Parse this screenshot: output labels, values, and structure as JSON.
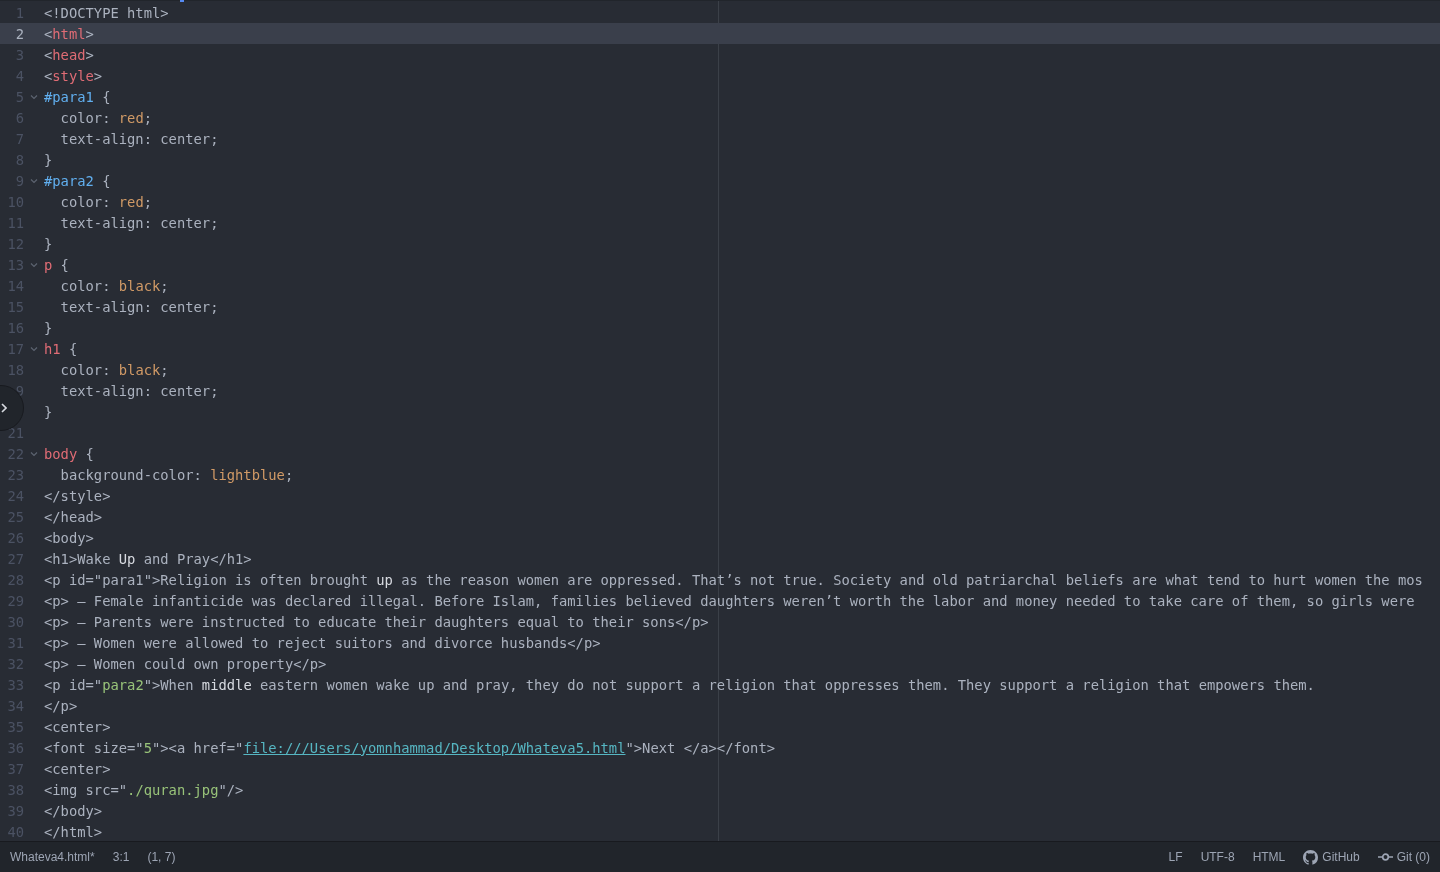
{
  "editor": {
    "lines": [
      {
        "number": "1",
        "fold": false,
        "current": false,
        "tokens": [
          {
            "kind": "text",
            "text": "<!DOCTYPE html>"
          }
        ]
      },
      {
        "number": "2",
        "fold": false,
        "current": true,
        "tokens": [
          {
            "kind": "text",
            "text": "<"
          },
          {
            "kind": "tag",
            "text": "html"
          },
          {
            "kind": "text",
            "text": ">"
          }
        ]
      },
      {
        "number": "3",
        "fold": false,
        "current": false,
        "tokens": [
          {
            "kind": "text",
            "text": "<"
          },
          {
            "kind": "tag",
            "text": "head"
          },
          {
            "kind": "text",
            "text": ">"
          }
        ]
      },
      {
        "number": "4",
        "fold": false,
        "current": false,
        "tokens": [
          {
            "kind": "text",
            "text": "<"
          },
          {
            "kind": "tag",
            "text": "style"
          },
          {
            "kind": "text",
            "text": ">"
          }
        ]
      },
      {
        "number": "5",
        "fold": true,
        "current": false,
        "tokens": [
          {
            "kind": "selector",
            "text": "#para1"
          },
          {
            "kind": "text",
            "text": " {"
          }
        ]
      },
      {
        "number": "6",
        "fold": false,
        "current": false,
        "tokens": [
          {
            "kind": "text",
            "text": "  color: "
          },
          {
            "kind": "value",
            "text": "red"
          },
          {
            "kind": "text",
            "text": ";"
          }
        ]
      },
      {
        "number": "7",
        "fold": false,
        "current": false,
        "tokens": [
          {
            "kind": "text",
            "text": "  text-align: center;"
          }
        ]
      },
      {
        "number": "8",
        "fold": false,
        "current": false,
        "tokens": [
          {
            "kind": "text",
            "text": "}"
          }
        ]
      },
      {
        "number": "9",
        "fold": true,
        "current": false,
        "tokens": [
          {
            "kind": "selector",
            "text": "#para2"
          },
          {
            "kind": "text",
            "text": " {"
          }
        ]
      },
      {
        "number": "10",
        "fold": false,
        "current": false,
        "tokens": [
          {
            "kind": "text",
            "text": "  color: "
          },
          {
            "kind": "value",
            "text": "red"
          },
          {
            "kind": "text",
            "text": ";"
          }
        ]
      },
      {
        "number": "11",
        "fold": false,
        "current": false,
        "tokens": [
          {
            "kind": "text",
            "text": "  text-align: center;"
          }
        ]
      },
      {
        "number": "12",
        "fold": false,
        "current": false,
        "tokens": [
          {
            "kind": "text",
            "text": "}"
          }
        ]
      },
      {
        "number": "13",
        "fold": true,
        "current": false,
        "tokens": [
          {
            "kind": "tag",
            "text": "p"
          },
          {
            "kind": "text",
            "text": " {"
          }
        ]
      },
      {
        "number": "14",
        "fold": false,
        "current": false,
        "tokens": [
          {
            "kind": "text",
            "text": "  color: "
          },
          {
            "kind": "value",
            "text": "black"
          },
          {
            "kind": "text",
            "text": ";"
          }
        ]
      },
      {
        "number": "15",
        "fold": false,
        "current": false,
        "tokens": [
          {
            "kind": "text",
            "text": "  text-align: center;"
          }
        ]
      },
      {
        "number": "16",
        "fold": false,
        "current": false,
        "tokens": [
          {
            "kind": "text",
            "text": "}"
          }
        ]
      },
      {
        "number": "17",
        "fold": true,
        "current": false,
        "tokens": [
          {
            "kind": "tag",
            "text": "h1"
          },
          {
            "kind": "text",
            "text": " {"
          }
        ]
      },
      {
        "number": "18",
        "fold": false,
        "current": false,
        "tokens": [
          {
            "kind": "text",
            "text": "  color: "
          },
          {
            "kind": "value",
            "text": "black"
          },
          {
            "kind": "text",
            "text": ";"
          }
        ]
      },
      {
        "number": "9",
        "fold": false,
        "current": false,
        "tokens": [
          {
            "kind": "text",
            "text": "  text-align: center;"
          }
        ]
      },
      {
        "fold": false,
        "current": false,
        "tokens": [
          {
            "kind": "text",
            "text": "}"
          }
        ]
      },
      {
        "number": "21",
        "fold": false,
        "current": false
      },
      {
        "number": "22",
        "fold": true,
        "current": false,
        "tokens": [
          {
            "kind": "tag",
            "text": "body"
          },
          {
            "kind": "text",
            "text": " {"
          }
        ]
      },
      {
        "number": "23",
        "fold": false,
        "current": false,
        "tokens": [
          {
            "kind": "text",
            "text": "  background-color: "
          },
          {
            "kind": "value",
            "text": "lightblue"
          },
          {
            "kind": "text",
            "text": ";"
          }
        ]
      },
      {
        "number": "24",
        "fold": false,
        "current": false,
        "tokens": [
          {
            "kind": "text",
            "text": "</style>"
          }
        ]
      },
      {
        "number": "25",
        "fold": false,
        "current": false,
        "tokens": [
          {
            "kind": "text",
            "text": "</head>"
          }
        ]
      },
      {
        "number": "26",
        "fold": false,
        "current": false,
        "tokens": [
          {
            "kind": "text",
            "text": "<body>"
          }
        ]
      },
      {
        "number": "27",
        "fold": false,
        "current": false,
        "tokens": [
          {
            "kind": "text",
            "text": "<h1>Wake "
          },
          {
            "kind": "bright",
            "text": "Up"
          },
          {
            "kind": "text",
            "text": " and Pray</h1>"
          }
        ]
      },
      {
        "number": "28",
        "fold": false,
        "current": false,
        "tokens": [
          {
            "kind": "text",
            "text": "<p id=\"para1\">Religion is often brought "
          },
          {
            "kind": "bright",
            "text": "up"
          },
          {
            "kind": "text",
            "text": " as the reason women are oppressed. That’s not true. Society and old patriarchal beliefs are what tend to hurt women the mos"
          }
        ]
      },
      {
        "number": "29",
        "fold": false,
        "current": false,
        "tokens": [
          {
            "kind": "text",
            "text": "<p> – Female infanticide was declared illegal. Before Islam, families believed daughters weren’t worth the labor and money needed to take care of them, so girls were"
          }
        ]
      },
      {
        "number": "30",
        "fold": false,
        "current": false,
        "tokens": [
          {
            "kind": "text",
            "text": "<p> – Parents were instructed to educate their daughters equal to their sons</p>"
          }
        ]
      },
      {
        "number": "31",
        "fold": false,
        "current": false,
        "tokens": [
          {
            "kind": "text",
            "text": "<p> – Women were allowed to reject suitors and divorce husbands</p>"
          }
        ]
      },
      {
        "number": "32",
        "fold": false,
        "current": false,
        "tokens": [
          {
            "kind": "text",
            "text": "<p> – Women could own property</p>"
          }
        ]
      },
      {
        "number": "33",
        "fold": false,
        "current": false,
        "tokens": [
          {
            "kind": "text",
            "text": "<p id=\""
          },
          {
            "kind": "string",
            "text": "para2"
          },
          {
            "kind": "text",
            "text": "\">When "
          },
          {
            "kind": "bright",
            "text": "middle"
          },
          {
            "kind": "text",
            "text": " eastern women wake up and pray, they do not support a religion that oppresses them. They support a religion that empowers them."
          }
        ]
      },
      {
        "number": "34",
        "fold": false,
        "current": false,
        "tokens": [
          {
            "kind": "text",
            "text": "</p>"
          }
        ]
      },
      {
        "number": "35",
        "fold": false,
        "current": false,
        "tokens": [
          {
            "kind": "text",
            "text": "<center>"
          }
        ]
      },
      {
        "number": "36",
        "fold": false,
        "current": false,
        "tokens": [
          {
            "kind": "text",
            "text": "<font size=\""
          },
          {
            "kind": "string",
            "text": "5"
          },
          {
            "kind": "text",
            "text": "\"><a href=\""
          },
          {
            "kind": "link",
            "text": "file:///Users/yomnhammad/Desktop/Whateva5.html"
          },
          {
            "kind": "text",
            "text": "\">Next </a></font>"
          }
        ]
      },
      {
        "number": "37",
        "fold": false,
        "current": false,
        "tokens": [
          {
            "kind": "text",
            "text": "<center>"
          }
        ]
      },
      {
        "number": "38",
        "fold": false,
        "current": false,
        "tokens": [
          {
            "kind": "text",
            "text": "<img src=\""
          },
          {
            "kind": "string",
            "text": "./quran.jpg"
          },
          {
            "kind": "text",
            "text": "\"/>"
          }
        ]
      },
      {
        "number": "39",
        "fold": false,
        "current": false,
        "tokens": [
          {
            "kind": "text",
            "text": "</body>"
          }
        ]
      },
      {
        "number": "40",
        "fold": false,
        "current": false,
        "tokens": [
          {
            "kind": "text",
            "text": "</html>"
          }
        ]
      }
    ]
  },
  "status_bar": {
    "file": "Whateva4.html*",
    "cursor": "3:1",
    "selection": "(1, 7)",
    "line_ending": "LF",
    "encoding": "UTF-8",
    "grammar": "HTML",
    "github": "GitHub",
    "git": "Git (0)"
  }
}
